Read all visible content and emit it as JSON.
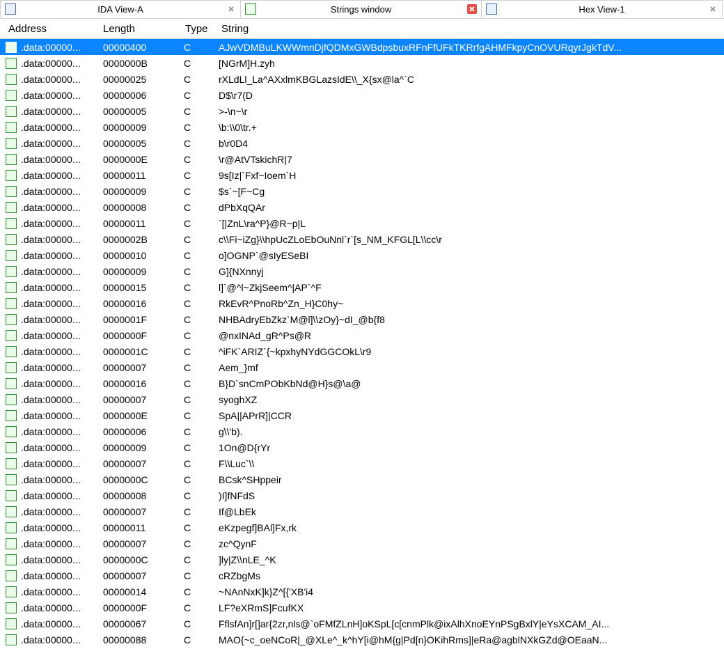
{
  "tabs": [
    {
      "title": "IDA View-A",
      "iconClass": "ic-ida",
      "closeClass": "close-grey",
      "active": false
    },
    {
      "title": "Strings window",
      "iconClass": "ic-str",
      "closeClass": "close-red",
      "active": true
    },
    {
      "title": "Hex View-1",
      "iconClass": "ic-hex",
      "closeClass": "close-grey",
      "active": false
    }
  ],
  "columns": {
    "address": "Address",
    "length": "Length",
    "type": "Type",
    "string": "String"
  },
  "rows": [
    {
      "address": ".data:00000...",
      "length": "00000400",
      "type": "C",
      "string": "AJwVDMBuLKWWmnDjfQDMxGWBdpsbuxRFnFfUFkTKRrfgAHMFkpyCnOVURqyrJgkTdV...",
      "selected": true
    },
    {
      "address": ".data:00000...",
      "length": "0000000B",
      "type": "C",
      "string": "[NGrM]H.zyh"
    },
    {
      "address": ".data:00000...",
      "length": "00000025",
      "type": "C",
      "string": "rXLdLl_La^AXxlmKBGLazsIdE\\\\_X{sx@la^`C"
    },
    {
      "address": ".data:00000...",
      "length": "00000006",
      "type": "C",
      "string": "D$\\r7(D"
    },
    {
      "address": ".data:00000...",
      "length": "00000005",
      "type": "C",
      "string": ">-\\n~\\r"
    },
    {
      "address": ".data:00000...",
      "length": "00000009",
      "type": "C",
      "string": "\\b:\\\\0\\tr.+"
    },
    {
      "address": ".data:00000...",
      "length": "00000005",
      "type": "C",
      "string": "b\\r0D4"
    },
    {
      "address": ".data:00000...",
      "length": "0000000E",
      "type": "C",
      "string": "\\r@AtVTskichR|7"
    },
    {
      "address": ".data:00000...",
      "length": "00000011",
      "type": "C",
      "string": "9s[Iz|`Fxf~Ioem`H"
    },
    {
      "address": ".data:00000...",
      "length": "00000009",
      "type": "C",
      "string": "$s`~[F~Cg"
    },
    {
      "address": ".data:00000...",
      "length": "00000008",
      "type": "C",
      "string": "dPbXqQAr"
    },
    {
      "address": ".data:00000...",
      "length": "00000011",
      "type": "C",
      "string": "`[|ZnL\\ra^P}@R~p|L"
    },
    {
      "address": ".data:00000...",
      "length": "0000002B",
      "type": "C",
      "string": "c\\\\Fi~iZg}\\\\hpUcZLoEbOuNnl`r`[s_NM_KFGL[L\\\\cc\\r"
    },
    {
      "address": ".data:00000...",
      "length": "00000010",
      "type": "C",
      "string": "o]OGNP`@sIyESeBI"
    },
    {
      "address": ".data:00000...",
      "length": "00000009",
      "type": "C",
      "string": "G]{NXnnyj"
    },
    {
      "address": ".data:00000...",
      "length": "00000015",
      "type": "C",
      "string": "l]`@^l~ZkjSeem^|AP`^F"
    },
    {
      "address": ".data:00000...",
      "length": "00000016",
      "type": "C",
      "string": "RkEvR^PnoRb^Zn_H}C0hy~"
    },
    {
      "address": ".data:00000...",
      "length": "0000001F",
      "type": "C",
      "string": "NHBAdryEbZkz`M@l]\\\\zOy}~dI_@b{f8"
    },
    {
      "address": ".data:00000...",
      "length": "0000000F",
      "type": "C",
      "string": "@nxINAd_gR^Ps@R"
    },
    {
      "address": ".data:00000...",
      "length": "0000001C",
      "type": "C",
      "string": "^iFK`ARIZ`{~kpxhyNYdGGCOkL\\r9"
    },
    {
      "address": ".data:00000...",
      "length": "00000007",
      "type": "C",
      "string": "Aem_}mf"
    },
    {
      "address": ".data:00000...",
      "length": "00000016",
      "type": "C",
      "string": "B}D`snCmPObKbNd@H}s@\\a@"
    },
    {
      "address": ".data:00000...",
      "length": "00000007",
      "type": "C",
      "string": "syoghXZ"
    },
    {
      "address": ".data:00000...",
      "length": "0000000E",
      "type": "C",
      "string": "SpA||APrR]|CCR"
    },
    {
      "address": ".data:00000...",
      "length": "00000006",
      "type": "C",
      "string": "g\\\\'b)."
    },
    {
      "address": ".data:00000...",
      "length": "00000009",
      "type": "C",
      "string": "1On@D{rYr"
    },
    {
      "address": ".data:00000...",
      "length": "00000007",
      "type": "C",
      "string": "F\\\\Luc`\\\\"
    },
    {
      "address": ".data:00000...",
      "length": "0000000C",
      "type": "C",
      "string": "BCsk^SHppeir"
    },
    {
      "address": ".data:00000...",
      "length": "00000008",
      "type": "C",
      "string": ")I]fNFdS"
    },
    {
      "address": ".data:00000...",
      "length": "00000007",
      "type": "C",
      "string": "If@LbEk"
    },
    {
      "address": ".data:00000...",
      "length": "00000011",
      "type": "C",
      "string": "eKzpegf]BAl]Fx,rk"
    },
    {
      "address": ".data:00000...",
      "length": "00000007",
      "type": "C",
      "string": "zc^QynF"
    },
    {
      "address": ".data:00000...",
      "length": "0000000C",
      "type": "C",
      "string": "]ly|Z\\\\nLE_^K"
    },
    {
      "address": ".data:00000...",
      "length": "00000007",
      "type": "C",
      "string": "cRZbgMs"
    },
    {
      "address": ".data:00000...",
      "length": "00000014",
      "type": "C",
      "string": "~NAnNxK]k}Z^[{'XB'i4"
    },
    {
      "address": ".data:00000...",
      "length": "0000000F",
      "type": "C",
      "string": "LF?eXRmS]FcufKX"
    },
    {
      "address": ".data:00000...",
      "length": "00000067",
      "type": "C",
      "string": "FflsfAn]r[]ar{2zr,nls@`oFMfZLnH]oKSpL[c[cnmPlk@ixAlhXnoEYnPSgBxlY|eYsXCAM_AI..."
    },
    {
      "address": ".data:00000...",
      "length": "00000088",
      "type": "C",
      "string": "MAO{~c_oeNCoR|_@XLe^_k^hY[i@hM{g|Pd[n}OKihRms]|eRa@agblNXkGZd@OEaaN..."
    }
  ]
}
